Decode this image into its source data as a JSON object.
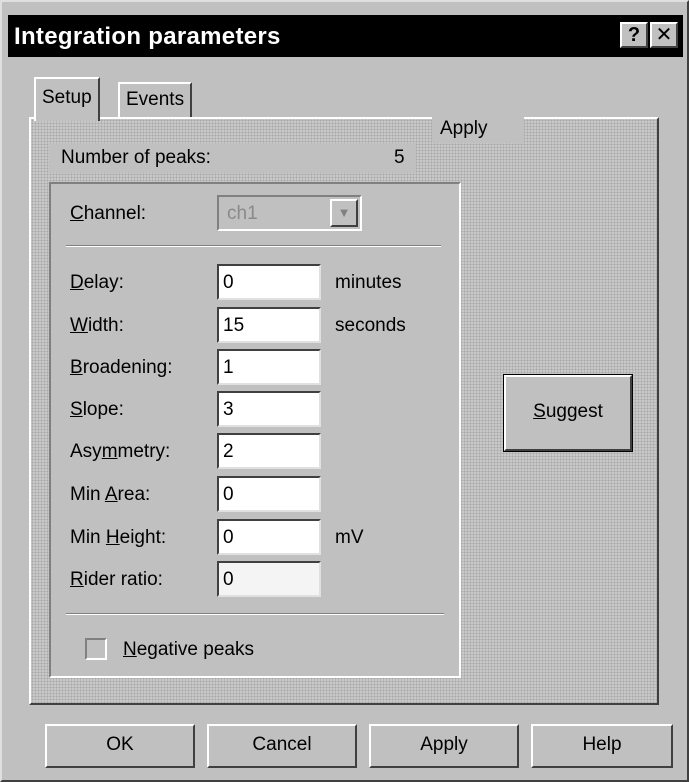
{
  "window": {
    "title": "Integration parameters",
    "help_button": "?",
    "close_button": "✕"
  },
  "tabs": [
    {
      "label": "Setup"
    },
    {
      "label": "Events"
    }
  ],
  "apply_header": "Apply",
  "number_of_peaks": {
    "label": "Number of peaks:",
    "value": "5"
  },
  "channel": {
    "label_first": "C",
    "label_rest": "hannel:",
    "value": "ch1"
  },
  "fields": [
    {
      "key": "delay",
      "pre": "",
      "u": "D",
      "post": "elay:",
      "value": "0",
      "unit": "minutes"
    },
    {
      "key": "width",
      "pre": "",
      "u": "W",
      "post": "idth:",
      "value": "15",
      "unit": "seconds"
    },
    {
      "key": "broadening",
      "pre": "",
      "u": "B",
      "post": "roadening:",
      "value": "1",
      "unit": ""
    },
    {
      "key": "slope",
      "pre": "",
      "u": "S",
      "post": "lope:",
      "value": "3",
      "unit": ""
    },
    {
      "key": "asymmetry",
      "pre": "Asy",
      "u": "m",
      "post": "metry:",
      "value": "2",
      "unit": ""
    },
    {
      "key": "min-area",
      "pre": "Min ",
      "u": "A",
      "post": "rea:",
      "value": "0",
      "unit": ""
    },
    {
      "key": "min-height",
      "pre": "Min ",
      "u": "H",
      "post": "eight:",
      "value": "0",
      "unit": "mV"
    },
    {
      "key": "rider-ratio",
      "pre": "",
      "u": "R",
      "post": "ider ratio:",
      "value": "0",
      "unit": ""
    }
  ],
  "negative_peaks": {
    "u": "N",
    "post": "egative peaks",
    "checked": false
  },
  "suggest_button": {
    "u": "S",
    "post": "uggest"
  },
  "buttons": {
    "ok": "OK",
    "cancel": "Cancel",
    "apply": "Apply",
    "help": "Help"
  },
  "colors": {
    "face": "#c0c0c0",
    "titlebar": "#000000",
    "disabled_text": "#8a8a8a"
  }
}
